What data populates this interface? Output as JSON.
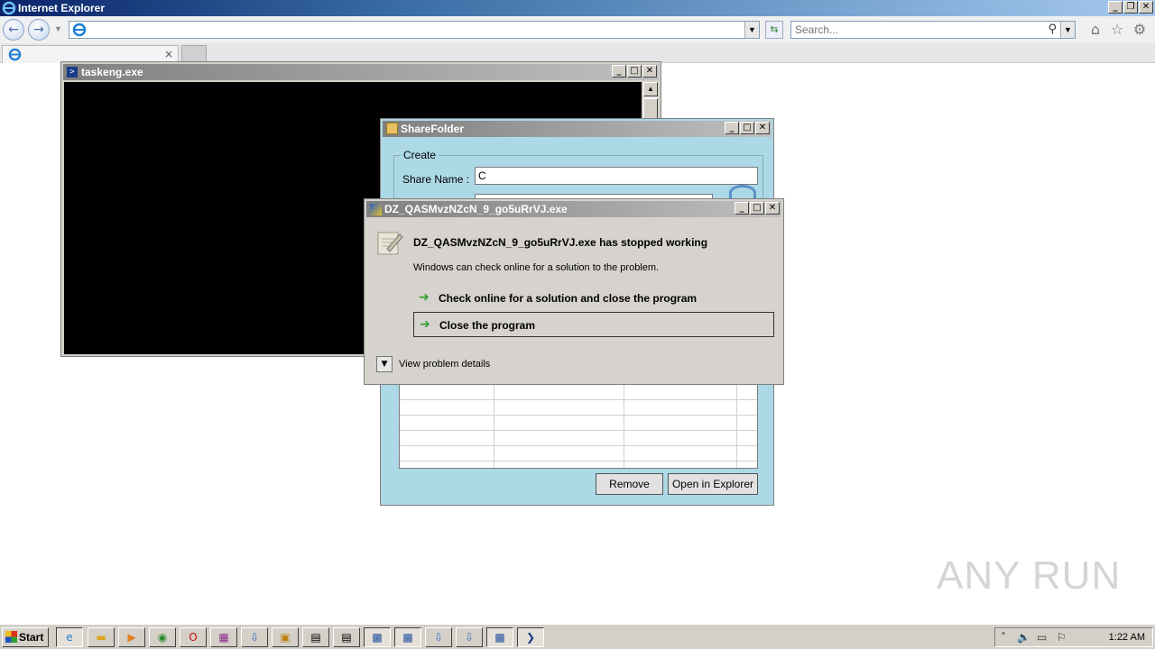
{
  "browser": {
    "title": "Internet Explorer",
    "address_value": "",
    "search_placeholder": "Search...",
    "tab_close": "×"
  },
  "console_window": {
    "title": "taskeng.exe"
  },
  "sharefolder": {
    "title": "ShareFolder",
    "group_label": "Create",
    "share_name_label": "Share Name :",
    "share_name_value": "C",
    "remove_button": "Remove",
    "open_button": "Open in Explorer"
  },
  "error_dialog": {
    "title": "DZ_QASMvzNZcN_9_go5uRrVJ.exe",
    "heading": "DZ_QASMvzNZcN_9_go5uRrVJ.exe has stopped working",
    "subtext": "Windows can check online for a solution to the problem.",
    "option_check": "Check online for a solution and close the program",
    "option_close": "Close the program",
    "details": "View problem details"
  },
  "watermark": "ANY RUN",
  "taskbar": {
    "start": "Start",
    "clock": "1:22 AM",
    "items": [
      "ie-icon",
      "explorer-icon",
      "media-player-icon",
      "chrome-icon",
      "opera-icon",
      "winrar-icon",
      "download-icon",
      "sharefolder-icon",
      "app-icon",
      "app-icon",
      "exe-icon",
      "exe-icon",
      "download-icon",
      "download-icon",
      "exe-icon",
      "console-icon"
    ]
  },
  "colors": {
    "titlebar_active": "#0a246a",
    "sharefolder_bg": "#add8e6",
    "dialog_bg": "#d6d3ce",
    "arrow_green": "#2f9e2f"
  }
}
